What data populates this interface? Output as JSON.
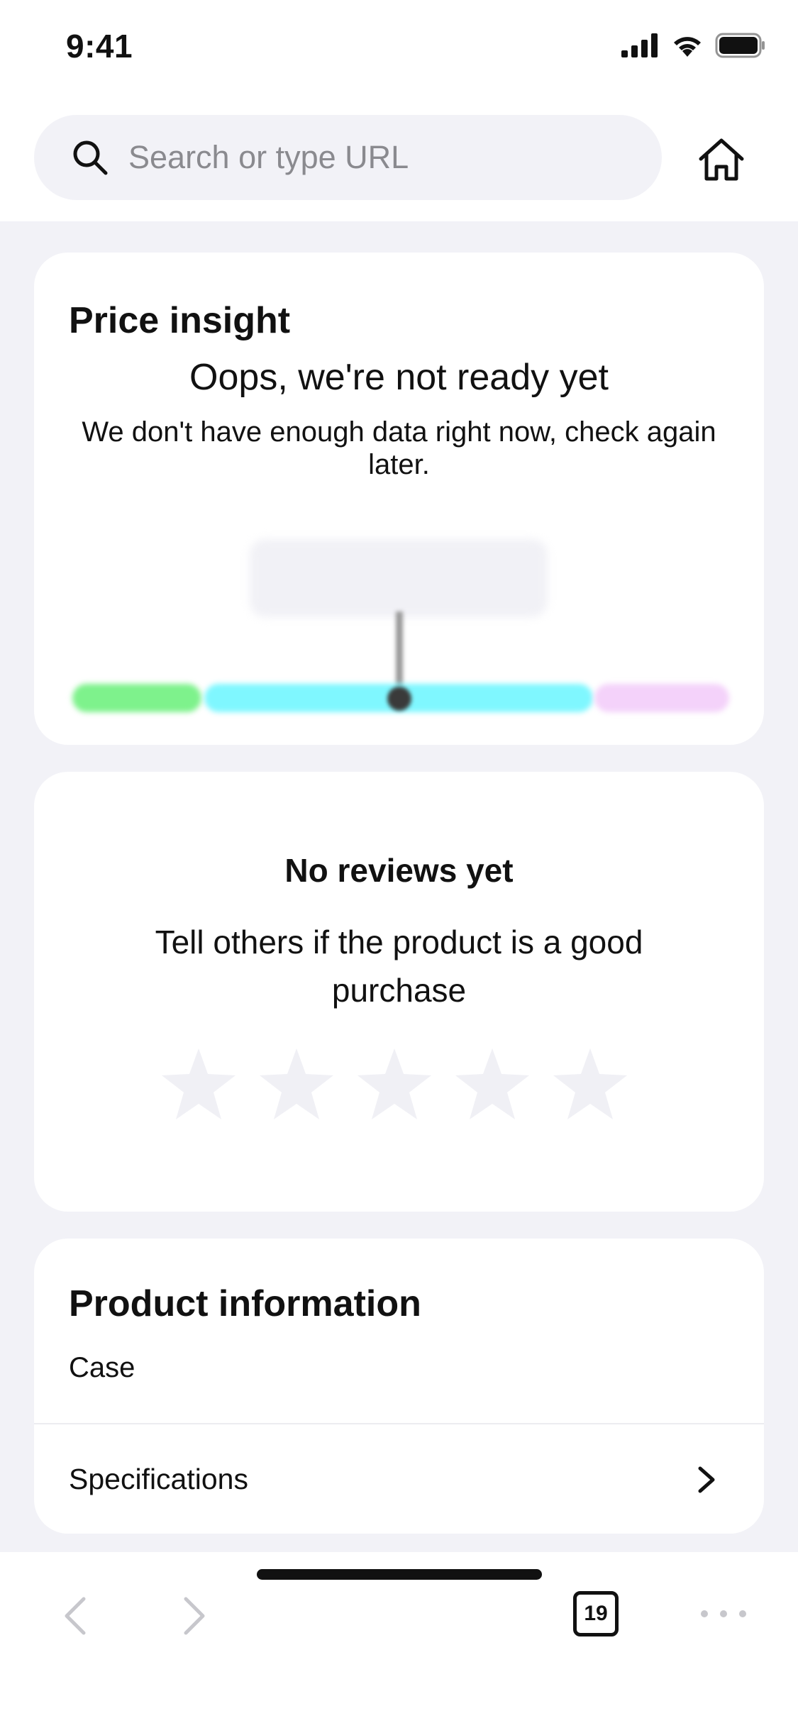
{
  "status_bar": {
    "time": "9:41",
    "icons": [
      "signal-icon",
      "wifi-icon",
      "battery-icon"
    ]
  },
  "header": {
    "search_placeholder": "Search or type URL",
    "search_icon": "search-icon",
    "home_icon": "home-icon"
  },
  "price_insight": {
    "title": "Price insight",
    "heading": "Oops, we're not ready yet",
    "description": "We don't have enough data right now, check again later.",
    "range_colors": [
      "#7ef28c",
      "#7ff7ff",
      "#f4d2fa"
    ]
  },
  "reviews": {
    "title": "No reviews yet",
    "description": "Tell others if the product is a good purchase",
    "rating": {
      "filled": 0,
      "max": 5
    },
    "star_color": "#f0f0f5"
  },
  "product_info": {
    "title": "Product information",
    "category": "Case",
    "specifications_label": "Specifications"
  },
  "toolbar": {
    "tab_count": "19",
    "back_icon": "chevron-left-icon",
    "forward_icon": "chevron-right-icon",
    "more_icon": "more-icon"
  },
  "colors": {
    "background": "#f2f2f7",
    "card": "#ffffff",
    "text": "#111111",
    "disabled": "#c7c7cc"
  }
}
